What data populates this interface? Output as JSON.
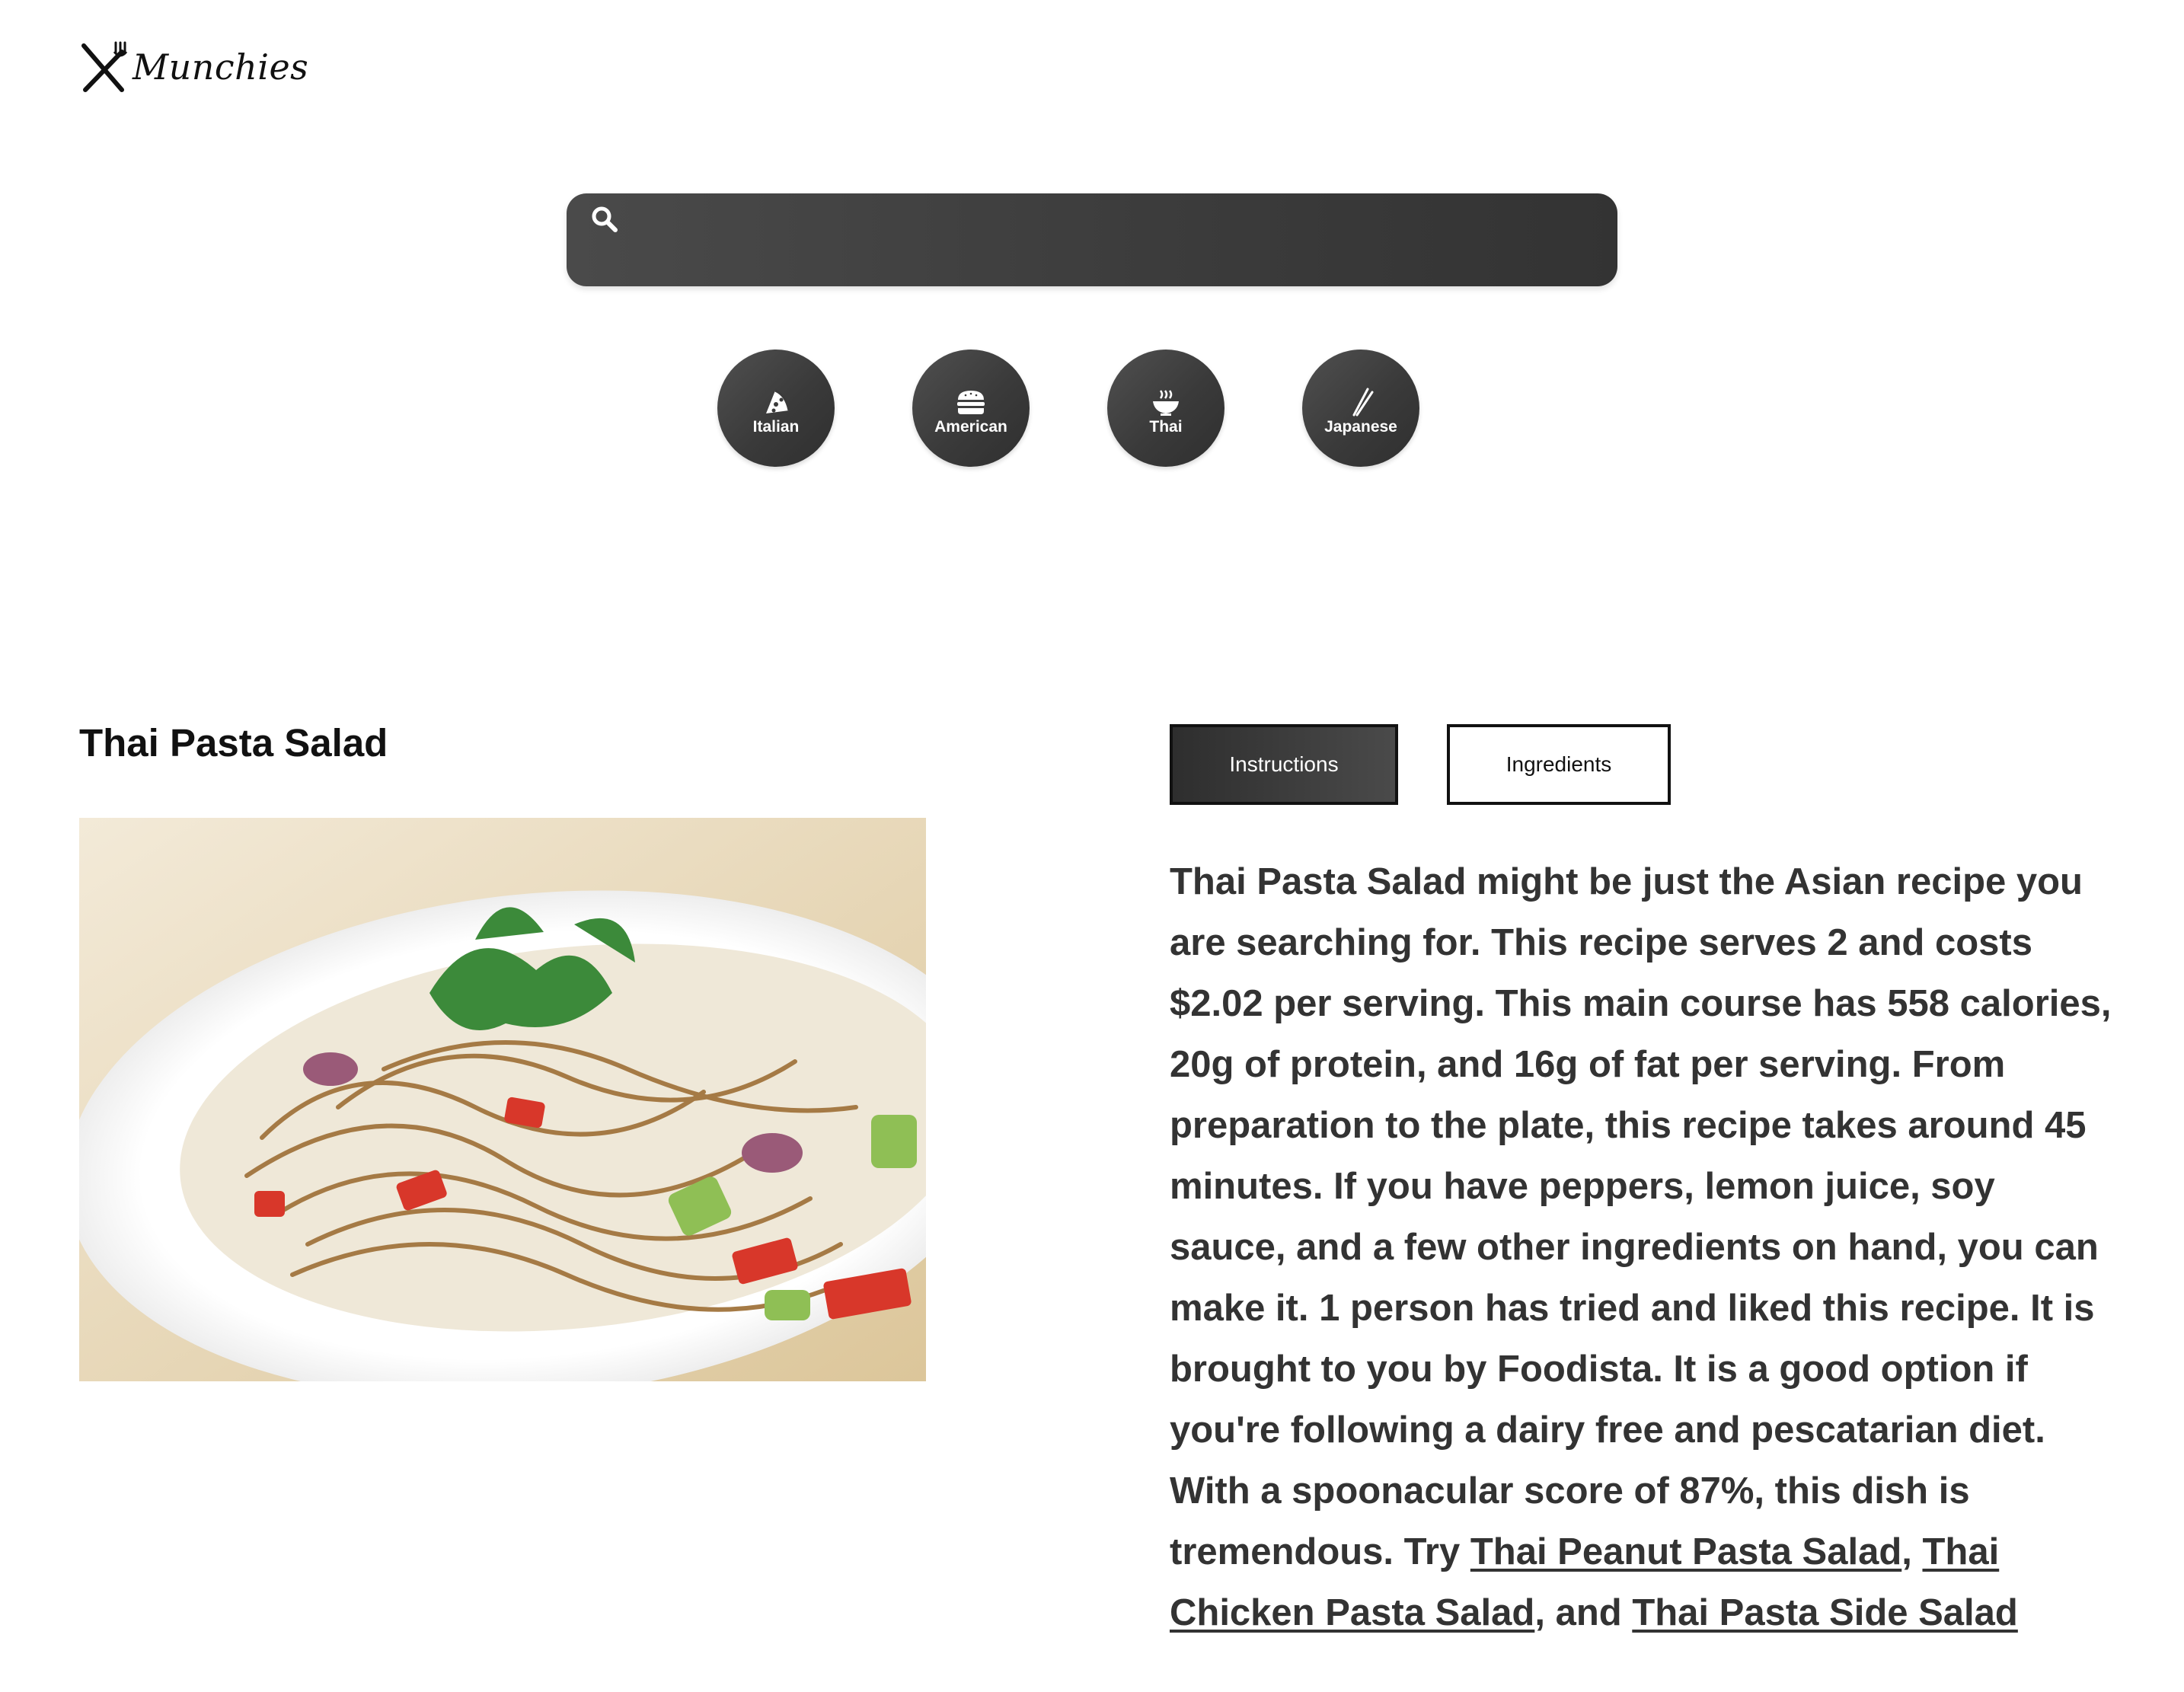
{
  "brand": {
    "name": "Munchies"
  },
  "search": {
    "placeholder": "",
    "value": ""
  },
  "cuisines": [
    {
      "label": "Italian",
      "icon": "pizza-icon"
    },
    {
      "label": "American",
      "icon": "burger-icon"
    },
    {
      "label": "Thai",
      "icon": "noodle-bowl-icon"
    },
    {
      "label": "Japanese",
      "icon": "chopsticks-icon"
    }
  ],
  "recipe": {
    "title": "Thai Pasta Salad",
    "tabs": {
      "instructions": "Instructions",
      "ingredients": "Ingredients"
    },
    "summary_text": "Thai Pasta Salad might be just the Asian recipe you are searching for. This recipe serves 2 and costs $2.02 per serving. This main course has 558 calories, 20g of protein, and 16g of fat per serving. From preparation to the plate, this recipe takes around 45 minutes. If you have peppers, lemon juice, soy sauce, and a few other ingredients on hand, you can make it. 1 person has tried and liked this recipe. It is brought to you by Foodista. It is a good option if you're following a dairy free and pescatarian diet. With a spoonacular score of 87%, this dish is tremendous. Try ",
    "related": [
      "Thai Peanut Pasta Salad",
      "Thai Chicken Pasta Salad",
      "Thai Pasta Side Salad"
    ],
    "sep1": ", ",
    "sep2": ", and "
  },
  "colors": {
    "dark": "#3a3a3a",
    "text": "#333333"
  }
}
